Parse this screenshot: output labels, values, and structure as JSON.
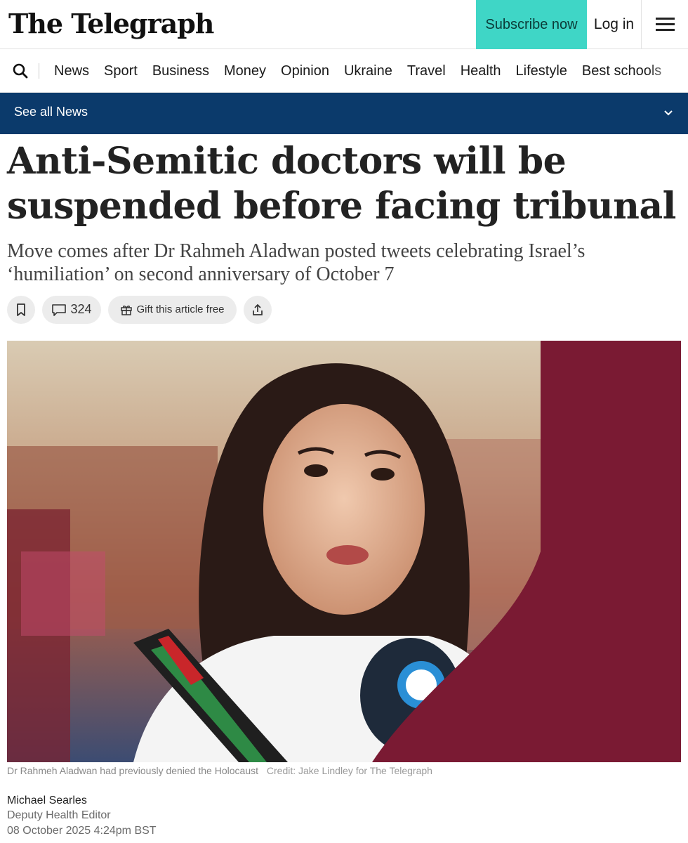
{
  "header": {
    "logo": "The Telegraph",
    "subscribe_label": "Subscribe now",
    "login_label": "Log in",
    "menu_icon": "hamburger-icon",
    "accent_color": "#3fd6c6"
  },
  "nav": {
    "search_icon": "search-icon",
    "items": [
      "News",
      "Sport",
      "Business",
      "Money",
      "Opinion",
      "Ukraine",
      "Travel",
      "Health",
      "Lifestyle",
      "Best schools"
    ]
  },
  "section_bar": {
    "label": "See all News",
    "icon": "chevron-down-icon",
    "color": "#0b3a6b"
  },
  "article": {
    "headline": "Anti-Semitic doctors will be suspended before facing tribunal",
    "standfirst": "Move comes after Dr Rahmeh Aladwan posted tweets celebrating Israel’s ‘humiliation’ on second anniversary of October 7",
    "comment_count": "324",
    "gift_label": "Gift this article free",
    "image_caption": "Dr Rahmeh Aladwan had previously denied the Holocaust",
    "image_credit": "Credit: Jake Lindley for The Telegraph",
    "author": "Michael Searles",
    "author_role": "Deputy Health Editor",
    "date": "08 October 2025 4:24pm BST"
  }
}
